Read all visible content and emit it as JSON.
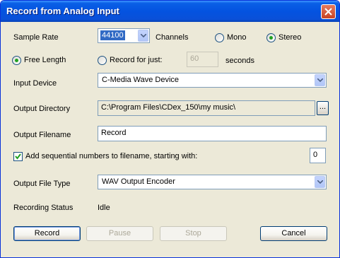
{
  "window": {
    "title": "Record from Analog Input"
  },
  "sample_rate": {
    "label": "Sample Rate",
    "value": "44100"
  },
  "channels": {
    "label": "Channels",
    "mono_label": "Mono",
    "stereo_label": "Stereo",
    "selected": "Stereo"
  },
  "length": {
    "free_label": "Free Length",
    "record_for_label": "Record for just:",
    "seconds_value": "60",
    "seconds_label": "seconds",
    "selected": "Free Length"
  },
  "input_device": {
    "label": "Input Device",
    "value": "C-Media Wave Device"
  },
  "output_directory": {
    "label": "Output Directory",
    "value": "C:\\Program Files\\CDex_150\\my music\\",
    "browse_label": "..."
  },
  "output_filename": {
    "label": "Output Filename",
    "value": "Record"
  },
  "sequential": {
    "label": "Add sequential numbers to filename, starting with:",
    "checked": true,
    "start_value": "0"
  },
  "output_file_type": {
    "label": "Output File Type",
    "value": "WAV Output Encoder"
  },
  "recording_status": {
    "label": "Recording Status",
    "value": "Idle"
  },
  "buttons": {
    "record": "Record",
    "pause": "Pause",
    "stop": "Stop",
    "cancel": "Cancel"
  },
  "colors": {
    "titlebar": "#0453E0",
    "dialog_bg": "#ECE9D8",
    "selection": "#316AC5",
    "radio_dot": "#21A121"
  }
}
